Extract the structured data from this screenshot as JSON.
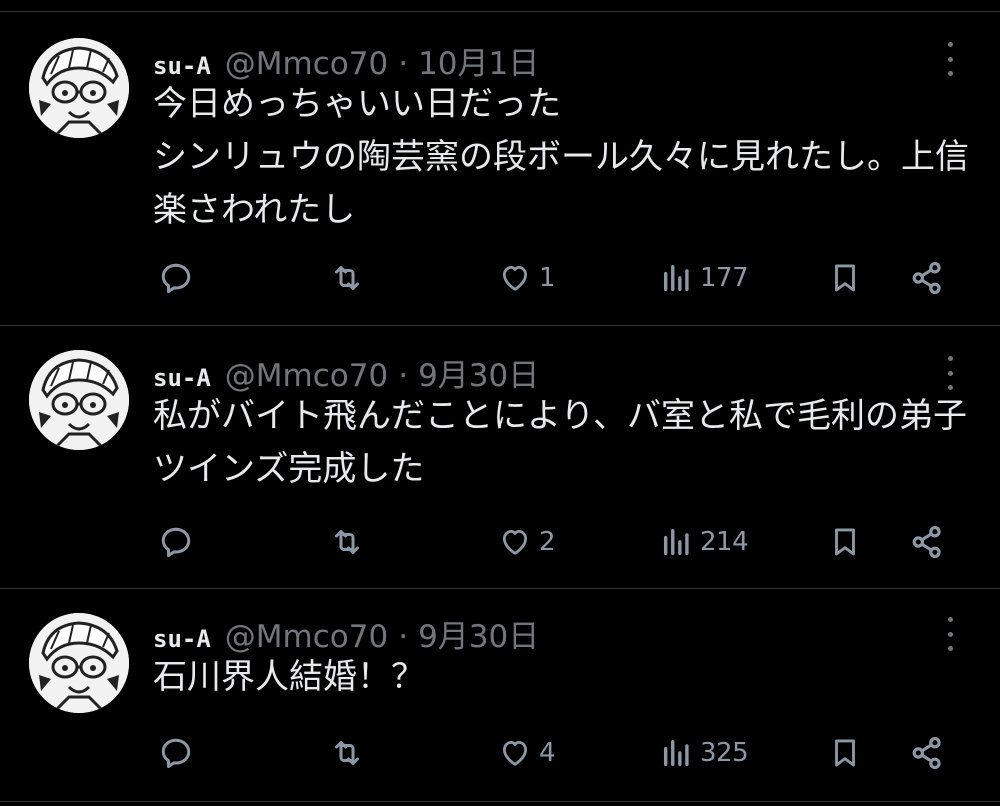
{
  "colors": {
    "background": "#000000",
    "text": "#e7e9ea",
    "muted": "#71767b",
    "divider": "#2f3336"
  },
  "tweets": [
    {
      "display_name": "su-A",
      "handle": "@Mmco70",
      "separator": "·",
      "date": "10月1日",
      "text": "今日めっちゃいい日だった\nシンリュウの陶芸窯の段ボール久々に見れたし。上信楽さわれたし",
      "likes": "1",
      "views": "177"
    },
    {
      "display_name": "su-A",
      "handle": "@Mmco70",
      "separator": "·",
      "date": "9月30日",
      "text": "私がバイト飛んだことにより、バ室と私で毛利の弟子ツインズ完成した",
      "likes": "2",
      "views": "214"
    },
    {
      "display_name": "su-A",
      "handle": "@Mmco70",
      "separator": "·",
      "date": "9月30日",
      "text": "石川界人結婚！？",
      "likes": "4",
      "views": "325"
    }
  ],
  "icons": {
    "reply": "reply-icon",
    "retweet": "retweet-icon",
    "like": "heart-icon",
    "views": "views-icon",
    "bookmark": "bookmark-icon",
    "share": "share-icon",
    "more": "more-icon"
  }
}
